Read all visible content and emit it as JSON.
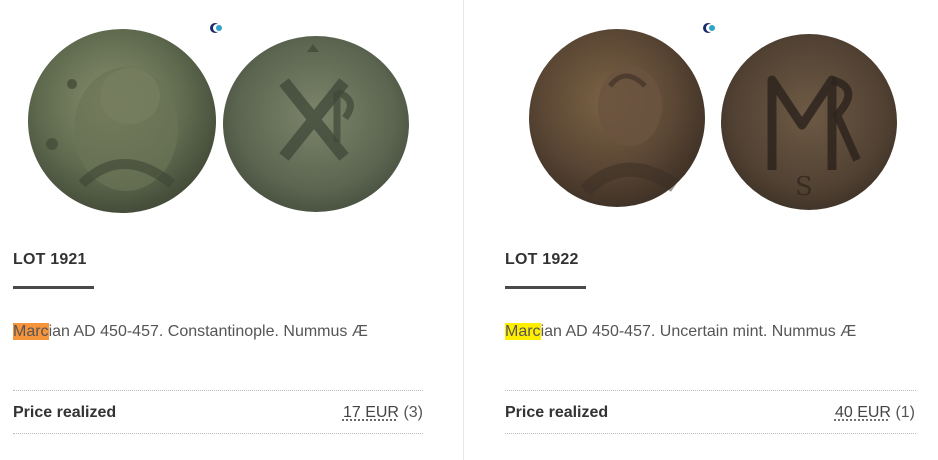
{
  "lots": [
    {
      "lot_label": "LOT 1921",
      "desc_highlight": "Marc",
      "desc_rest": "ian AD 450-457. Constantinople. Nummus Æ",
      "highlight_color": "#f5943a",
      "price_label": "Price realized",
      "price_amount": "17 EUR",
      "bids": "(3)"
    },
    {
      "lot_label": "LOT 1922",
      "desc_highlight": "Marc",
      "desc_rest": "ian AD 450-457. Uncertain mint. Nummus Æ",
      "highlight_color": "#ffee00",
      "price_label": "Price realized",
      "price_amount": "40 EUR",
      "bids": "(1)"
    }
  ]
}
